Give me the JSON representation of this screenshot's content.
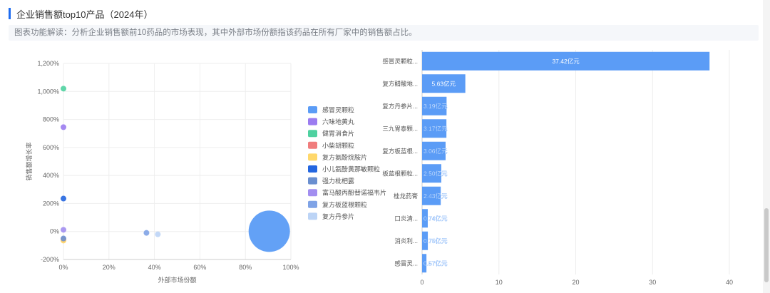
{
  "header": {
    "title": "企业销售额top10产品（2024年）",
    "description": "图表功能解读：分析企业销售额前10药品的市场表现，其中外部市场份额指该药品在所有厂家中的销售额占比。"
  },
  "chart_data": [
    {
      "type": "scatter",
      "xlabel": "外部市场份额",
      "ylabel": "销售额增长率",
      "xlim": [
        0,
        1
      ],
      "ylim": [
        -2,
        12
      ],
      "x_ticks": [
        "0%",
        "20%",
        "40%",
        "60%",
        "80%",
        "100%"
      ],
      "y_ticks": [
        "-200%",
        "0%",
        "200%",
        "400%",
        "600%",
        "800%",
        "1,000%",
        "1,200%"
      ],
      "grid": true,
      "legend_position": "right",
      "series": [
        {
          "name": "感冒灵颗粒",
          "color": "#5b9cf6",
          "x": 0.905,
          "y": 0.02,
          "bubble": "large"
        },
        {
          "name": "六味地黄丸",
          "color": "#9b7cf0",
          "x": 0.0,
          "y": 7.45,
          "bubble": "small"
        },
        {
          "name": "健胃消食片",
          "color": "#4fd1a0",
          "x": 0.0,
          "y": 10.2,
          "bubble": "small"
        },
        {
          "name": "小柴胡颗粒",
          "color": "#f07d7d",
          "x": 0.0,
          "y": -0.6,
          "bubble": "small"
        },
        {
          "name": "复方氨酚烷胺片",
          "color": "#ffd86b",
          "x": 0.0,
          "y": -0.65,
          "bubble": "small"
        },
        {
          "name": "小儿氨酚黄那敏颗粒",
          "color": "#2466e0",
          "x": 0.0,
          "y": 2.35,
          "bubble": "small"
        },
        {
          "name": "强力枇杷露",
          "color": "#6a8fd0",
          "x": 0.0,
          "y": -0.5,
          "bubble": "small"
        },
        {
          "name": "富马酸丙酚替诺福韦片",
          "color": "#a28ef0",
          "x": 0.0,
          "y": 0.12,
          "bubble": "small"
        },
        {
          "name": "复方板蓝根颗粒",
          "color": "#7fa3e6",
          "x": 0.365,
          "y": -0.1,
          "bubble": "small"
        },
        {
          "name": "复方丹参片",
          "color": "#bcd4f6",
          "x": 0.415,
          "y": -0.2,
          "bubble": "small"
        }
      ]
    },
    {
      "type": "bar",
      "orientation": "horizontal",
      "categories": [
        "感冒灵颗粒...",
        "复方醋酸地...",
        "复方丹参片...",
        "三九胃泰颗...",
        "复方板蓝根...",
        "板蓝根颗粒...",
        "桂龙药膏",
        "口炎清...",
        "消炎利...",
        "感冒灵..."
      ],
      "values": [
        37.42,
        5.63,
        3.19,
        3.17,
        3.06,
        2.5,
        2.43,
        0.74,
        0.75,
        0.57
      ],
      "data_labels": [
        "37.42亿元",
        "5.63亿元",
        "3.19亿元",
        "3.17亿元",
        "3.06亿元",
        "2.50亿元",
        "2.43亿元",
        "0.74亿元",
        "0.75亿元",
        "0.57亿元"
      ],
      "x_ticks": [
        "0",
        "10",
        "20",
        "30",
        "40"
      ],
      "xlim": [
        0,
        40
      ],
      "color": "#5b9cf6",
      "grid": true
    }
  ]
}
